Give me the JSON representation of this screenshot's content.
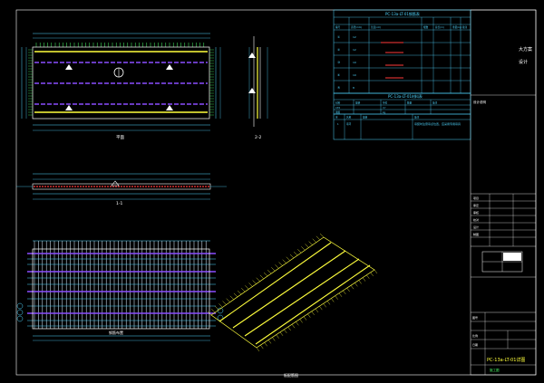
{
  "colors": {
    "background": "#000000",
    "frame": "#ffffff",
    "table_line": "#4fd6ff",
    "rebar_main": "#ffff3c",
    "rebar_dist": "#8a4dff",
    "rebar_red": "#ff3a3a",
    "tick_green": "#4cff6a",
    "mesh": "#4fd6ff"
  },
  "views": {
    "plan_label": "平面",
    "side_label": "2-2",
    "elev_label": "1-1",
    "mesh_label": "钢筋布置",
    "bottom_label": "板配筋图"
  },
  "table1": {
    "title": "PC-13a-LT-01钢筋表",
    "headers": [
      "编号",
      "直径(mm)",
      "长度(cm)",
      "根数",
      "总长(m)",
      "重量(kg)",
      "备注"
    ],
    "rows": [
      [
        "①",
        "12",
        "",
        "",
        "",
        "",
        ""
      ],
      [
        "②",
        "12",
        "",
        "",
        "",
        "",
        ""
      ],
      [
        "③",
        "10",
        "",
        "",
        "",
        "",
        ""
      ],
      [
        "④",
        "10",
        "",
        "",
        "",
        "",
        ""
      ],
      [
        "⑤",
        "8",
        "",
        "",
        "",
        "",
        ""
      ]
    ]
  },
  "table2": {
    "title": "PC-13a-LT-01材料表",
    "headers": [
      "材料",
      "规格",
      "单位",
      "数量",
      "备注"
    ],
    "rows": [
      [
        "C35",
        "",
        "m³",
        "",
        ""
      ],
      [
        "钢筋",
        "",
        "kg",
        "",
        ""
      ]
    ]
  },
  "table3": {
    "headers": [
      "序",
      "名称",
      "规格",
      "备注"
    ],
    "rows": [
      [
        "1",
        "吊环",
        "",
        "吊装时注意吊点位置，应采用专用吊具"
      ]
    ]
  },
  "notes_label": "设计说明",
  "title_block": {
    "company": "大方案",
    "company_sub": "设计",
    "drawing_name": "PC-13a-LT-01详图",
    "sheet_label": "图号",
    "sheet_value": "",
    "scale_label": "比例",
    "date_label": "日期",
    "status": "施工图",
    "rows": [
      "项目",
      "审定",
      "审核",
      "校对",
      "设计",
      "制图"
    ]
  }
}
